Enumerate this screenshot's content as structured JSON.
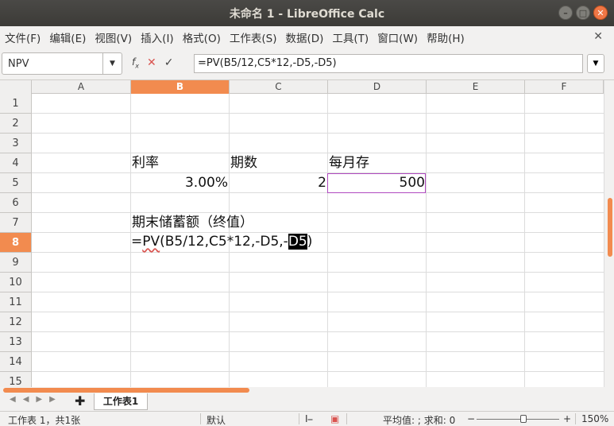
{
  "window": {
    "title": "未命名 1 - LibreOffice Calc",
    "buttons": {
      "minimize": "–",
      "maximize": "□",
      "close": "✕"
    }
  },
  "menu": [
    "文件(F)",
    "编辑(E)",
    "视图(V)",
    "插入(I)",
    "格式(O)",
    "工作表(S)",
    "数据(D)",
    "工具(T)",
    "窗口(W)",
    "帮助(H)"
  ],
  "document_close": "✕",
  "formula_bar": {
    "name_box": "NPV",
    "fx_icon": "fx-icon",
    "cancel_icon": "✕",
    "accept_icon": "✓",
    "formula": "=PV(B5/12,C5*12,-D5,-D5)"
  },
  "columns": [
    "A",
    "B",
    "C",
    "D",
    "E",
    "F"
  ],
  "selected_column": "B",
  "rows": [
    "1",
    "2",
    "3",
    "4",
    "5",
    "6",
    "7",
    "8",
    "9",
    "10",
    "11",
    "12",
    "13",
    "14",
    "15"
  ],
  "selected_row": "8",
  "cells": {
    "B4": "利率",
    "C4": "期数",
    "D4": "每月存",
    "B5": "3.00%",
    "C5": "2",
    "D5": "500",
    "B7": "期末储蓄额（终值）"
  },
  "editing_cell": {
    "address": "B8",
    "prefix": "=",
    "func": "PV",
    "middle": "(B5/12,C5*12,-D5,-",
    "selected_ref": "D5",
    "suffix": ")"
  },
  "sheet_tabs": {
    "nav": [
      "◀",
      "◀",
      "▶",
      "▶"
    ],
    "add": "✚",
    "active": "工作表1"
  },
  "status_bar": {
    "sheet_info": "工作表 1，共1张",
    "page_style": "默认",
    "insert_mode": "I⎯",
    "save_icon": "save-icon",
    "summary": "平均值: ; 求和: 0",
    "zoom_minus": "−",
    "zoom_plus": "+",
    "zoom": "150%"
  },
  "colors": {
    "accent": "#f28b4f",
    "title_bg": "#3c3b37",
    "cell_ref_border": "#b04ac0"
  }
}
